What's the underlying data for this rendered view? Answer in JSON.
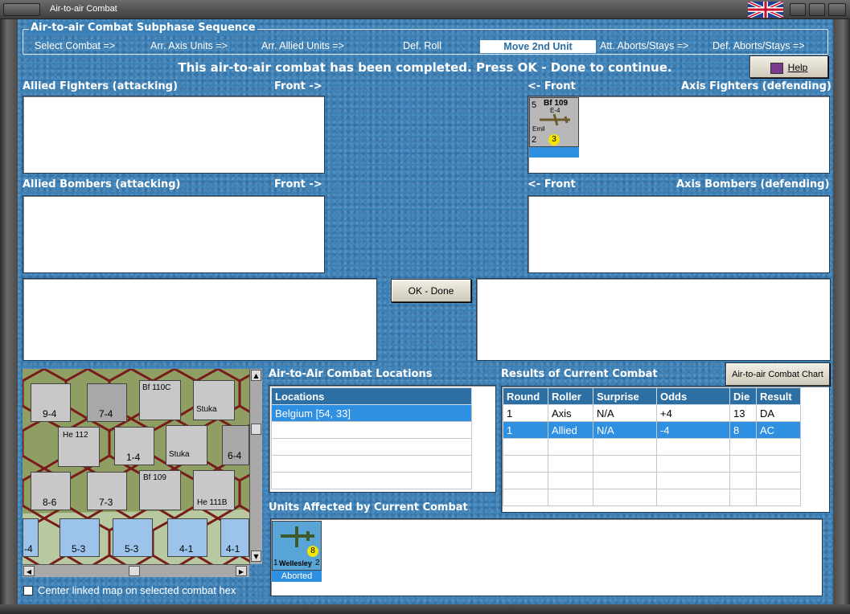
{
  "window": {
    "title": "Air-to-air Combat"
  },
  "sequence": {
    "title": "Air-to-air Combat Subphase Sequence",
    "steps": [
      "Select Combat =>",
      "Arr. Axis Units =>",
      "Arr. Allied Units =>",
      "Def. Roll",
      "Move 2nd Unit",
      "Att. Aborts/Stays =>",
      "Def. Aborts/Stays =>"
    ],
    "active_step": "Move 2nd Unit"
  },
  "status_message": "This air-to-air combat has been completed.  Press OK - Done to continue.",
  "help_label": "Help",
  "sections": {
    "allied_fighters": "Allied Fighters (attacking)",
    "allied_bombers": "Allied Bombers (attacking)",
    "axis_fighters": "Axis Fighters (defending)",
    "axis_bombers": "Axis Bombers (defending)",
    "front_right": "Front ->",
    "front_left": "<- Front"
  },
  "axis_fighter_unit": {
    "name": "Bf 109",
    "variant": "E-4",
    "nick": "Emil",
    "tl": "5",
    "bl": "2",
    "range": "3"
  },
  "ok_button": "OK - Done",
  "locations": {
    "title": "Air-to-Air Combat Locations",
    "header": "Locations",
    "rows": [
      "Belgium [54, 33]"
    ]
  },
  "results": {
    "title": "Results of Current Combat",
    "chart_button": "Air-to-air Combat Chart",
    "columns": [
      "Round",
      "Roller",
      "Surprise",
      "Odds",
      "Die",
      "Result"
    ],
    "rows": [
      [
        "1",
        "Axis",
        "N/A",
        "+4",
        "13",
        "DA"
      ],
      [
        "1",
        "Allied",
        "N/A",
        "-4",
        "8",
        "AC"
      ]
    ]
  },
  "affected": {
    "title": "Units Affected by Current Combat",
    "unit_name": "Wellesley",
    "unit_left": "1",
    "unit_right": "2",
    "unit_range": "8",
    "status": "Aborted"
  },
  "center_checkbox": {
    "label": "Center linked map on selected combat hex",
    "checked": false
  },
  "map": {
    "counters": [
      {
        "top": "XXX",
        "val": "9-4"
      },
      {
        "top": "XXX",
        "val": "7-4"
      },
      {
        "top": "Bf 110C",
        "val": "5"
      },
      {
        "top": "Stuka",
        "val": "4"
      },
      {
        "top": "He 112",
        "val": "5"
      },
      {
        "top": "",
        "val": "1-4"
      },
      {
        "top": "Stuka",
        "val": "3"
      },
      {
        "top": "",
        "val": "6-4"
      },
      {
        "top": "XXX",
        "val": "8-6"
      },
      {
        "top": "XXX",
        "val": "7-3"
      },
      {
        "top": "Bf 109",
        "val": "3"
      },
      {
        "top": "He 111B",
        "val": "4"
      },
      {
        "top": "",
        "val": "-4"
      },
      {
        "top": "XXX",
        "val": "5-3"
      },
      {
        "top": "XXX",
        "val": "5-3"
      },
      {
        "top": "",
        "val": "4-1"
      },
      {
        "top": "",
        "val": "4-1"
      }
    ]
  },
  "colors": {
    "panel": "#3a7fb5",
    "header": "#2d6fa3",
    "selection": "#2f8fe0"
  }
}
